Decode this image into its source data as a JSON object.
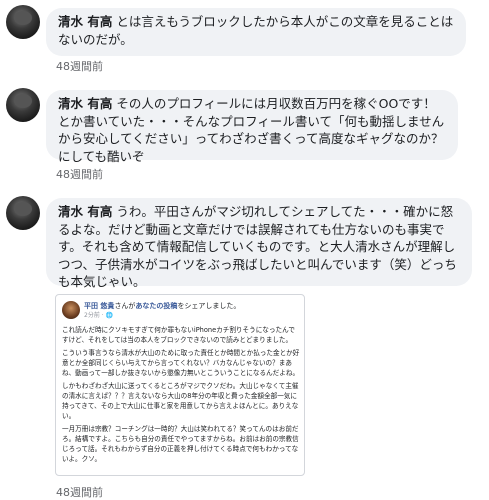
{
  "comments": [
    {
      "name": "清水 有高",
      "text": "とは言えもうブロックしたから本人がこの文章を見ることはないのだが。",
      "timestamp": "48週間前"
    },
    {
      "name": "清水 有高",
      "text": "その人のプロフィールには月収数百万円を稼ぐOOです！とか書いていた・・・そんなプロフィール書いて「何も動揺しませんから安心してください」ってわざわざ書くって高度なギャグなのか？にしても酷いぞ",
      "timestamp": "48週間前"
    },
    {
      "name": "清水 有高",
      "text": "うわ。平田さんがマジ切れしてシェアしてた・・・確かに怒るよな。だけど動画と文章だけでは誤解されても仕方ないのも事実です。それも含めて情報配信していくものです。と大人清水さんが理解しつつ、子供清水がコイツをぶっ飛ばしたいと叫んでいます（笑）どっちも本気じゃい。",
      "timestamp": "48週間前"
    }
  ],
  "shared_post": {
    "author": "平田 悠貴",
    "action_pre": "さんが",
    "action_link": "あなたの投稿",
    "action_post": "をシェアしました。",
    "time": "2分前 · ",
    "paragraphs": [
      "これ読んだ時にクソキモすぎて何か罪もないiPhoneカチ割りそうになったんですけど、それをしては当の本人をブロックできないので読みとどまりました。",
      "こういう事言うなら清水が大山のために取った責任とか時間とか払った金とか好意とか全部同じくらい与えてから言ってくれない？バカなんじゃないの？まあね、動画って一部しか抜きないから懲像力無いとこういうことになるんだよね。",
      "しかもわざわざ大山に送ってくるところがマジでクソだわ。大山じゃなくて主催の清水に言えば？？？言えないなら大山の8年分の年収と費った金額全部一気に持ってきて、その上で大山に仕事と家を用意してから言えよほんとに。ありえない。",
      "一月万冊は宗教？コーチングは一時的？大山は笑われてる？笑ってんのはお前だろ。結構ですよ。こちらも自分の責任でやってますからね。お前はお前の宗教信じろって話。それもわからず自分の正義を押し付けてくる時点で何もわかってないよ。クソ。"
    ]
  }
}
